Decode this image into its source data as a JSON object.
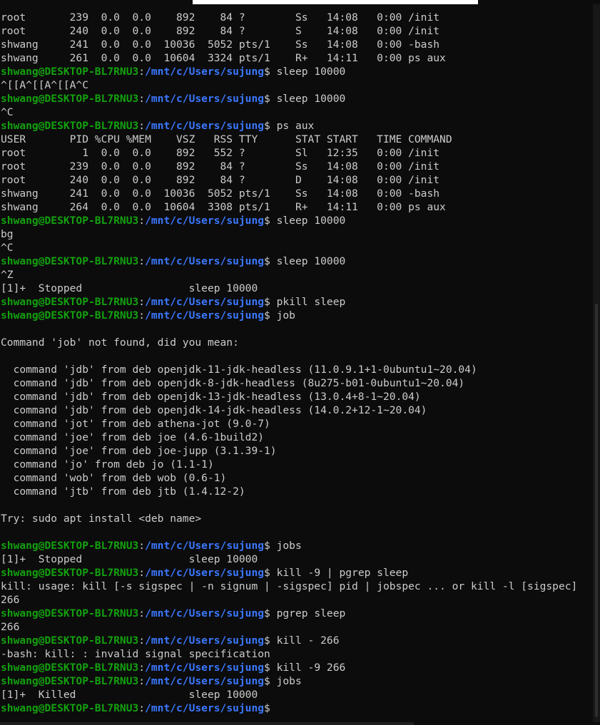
{
  "prompt": {
    "user_host": "shwang@DESKTOP-BL7RNU3",
    "colon": ":",
    "path": "/mnt/c/Users/sujung",
    "dollar": "$"
  },
  "lines": [
    {
      "type": "out",
      "text": "root       239  0.0  0.0    892    84 ?        Ss   14:08   0:00 /init"
    },
    {
      "type": "out",
      "text": "root       240  0.0  0.0    892    84 ?        S    14:08   0:00 /init"
    },
    {
      "type": "out",
      "text": "shwang     241  0.0  0.0  10036  5052 pts/1    Ss   14:08   0:00 -bash"
    },
    {
      "type": "out",
      "text": "shwang     261  0.0  0.0  10604  3324 pts/1    R+   14:11   0:00 ps aux"
    },
    {
      "type": "prompt",
      "cmd": " sleep 10000"
    },
    {
      "type": "out",
      "text": "^[[A^[[A^[[A^C"
    },
    {
      "type": "prompt",
      "cmd": " sleep 10000"
    },
    {
      "type": "out",
      "text": "^C"
    },
    {
      "type": "prompt",
      "cmd": " ps aux"
    },
    {
      "type": "out",
      "text": "USER       PID %CPU %MEM    VSZ   RSS TTY      STAT START   TIME COMMAND"
    },
    {
      "type": "out",
      "text": "root         1  0.0  0.0    892   552 ?        Sl   12:35   0:00 /init"
    },
    {
      "type": "out",
      "text": "root       239  0.0  0.0    892    84 ?        Ss   14:08   0:00 /init"
    },
    {
      "type": "out",
      "text": "root       240  0.0  0.0    892    84 ?        D    14:08   0:00 /init"
    },
    {
      "type": "out",
      "text": "shwang     241  0.0  0.0  10036  5052 pts/1    Ss   14:08   0:00 -bash"
    },
    {
      "type": "out",
      "text": "shwang     264  0.0  0.0  10604  3308 pts/1    R+   14:11   0:00 ps aux"
    },
    {
      "type": "prompt",
      "cmd": " sleep 10000"
    },
    {
      "type": "out",
      "text": "bg"
    },
    {
      "type": "out",
      "text": "^C"
    },
    {
      "type": "prompt",
      "cmd": " sleep 10000"
    },
    {
      "type": "out",
      "text": "^Z"
    },
    {
      "type": "out",
      "text": "[1]+  Stopped                 sleep 10000"
    },
    {
      "type": "prompt",
      "cmd": " pkill sleep"
    },
    {
      "type": "prompt",
      "cmd": " job"
    },
    {
      "type": "out",
      "text": ""
    },
    {
      "type": "out",
      "text": "Command 'job' not found, did you mean:"
    },
    {
      "type": "out",
      "text": ""
    },
    {
      "type": "out",
      "text": "  command 'jdb' from deb openjdk-11-jdk-headless (11.0.9.1+1-0ubuntu1~20.04)"
    },
    {
      "type": "out",
      "text": "  command 'jdb' from deb openjdk-8-jdk-headless (8u275-b01-0ubuntu1~20.04)"
    },
    {
      "type": "out",
      "text": "  command 'jdb' from deb openjdk-13-jdk-headless (13.0.4+8-1~20.04)"
    },
    {
      "type": "out",
      "text": "  command 'jdb' from deb openjdk-14-jdk-headless (14.0.2+12-1~20.04)"
    },
    {
      "type": "out",
      "text": "  command 'jot' from deb athena-jot (9.0-7)"
    },
    {
      "type": "out",
      "text": "  command 'joe' from deb joe (4.6-1build2)"
    },
    {
      "type": "out",
      "text": "  command 'joe' from deb joe-jupp (3.1.39-1)"
    },
    {
      "type": "out",
      "text": "  command 'jo' from deb jo (1.1-1)"
    },
    {
      "type": "out",
      "text": "  command 'wob' from deb wob (0.6-1)"
    },
    {
      "type": "out",
      "text": "  command 'jtb' from deb jtb (1.4.12-2)"
    },
    {
      "type": "out",
      "text": ""
    },
    {
      "type": "out",
      "text": "Try: sudo apt install <deb name>"
    },
    {
      "type": "out",
      "text": ""
    },
    {
      "type": "prompt",
      "cmd": " jobs"
    },
    {
      "type": "out",
      "text": "[1]+  Stopped                 sleep 10000"
    },
    {
      "type": "prompt",
      "cmd": " kill -9 | pgrep sleep"
    },
    {
      "type": "out",
      "text": "kill: usage: kill [-s sigspec | -n signum | -sigspec] pid | jobspec ... or kill -l [sigspec]"
    },
    {
      "type": "out",
      "text": "266"
    },
    {
      "type": "prompt",
      "cmd": " pgrep sleep"
    },
    {
      "type": "out",
      "text": "266"
    },
    {
      "type": "prompt",
      "cmd": " kill - 266"
    },
    {
      "type": "out",
      "text": "-bash: kill: : invalid signal specification"
    },
    {
      "type": "prompt",
      "cmd": " kill -9 266"
    },
    {
      "type": "prompt",
      "cmd": " jobs"
    },
    {
      "type": "out",
      "text": "[1]+  Killed                  sleep 10000"
    },
    {
      "type": "prompt",
      "cmd": ""
    }
  ]
}
